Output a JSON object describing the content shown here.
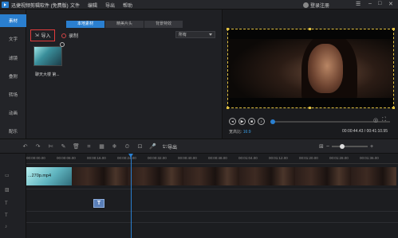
{
  "app": {
    "title": "迅捷视频剪辑软件 (免费版)",
    "menu": [
      "文件",
      "编辑",
      "导出",
      "帮助"
    ],
    "login": "登录注册"
  },
  "sidebar": {
    "items": [
      "素材",
      "文字",
      "滤镜",
      "叠附",
      "转场",
      "动画",
      "配乐"
    ],
    "active_index": 0
  },
  "media": {
    "tabs": [
      "本地素材",
      "精美片头",
      "背景特效"
    ],
    "active_tab": 0,
    "import_label": "导入",
    "record_label": "录制",
    "filter_value": "所有",
    "item_caption": "聊天大楼 第..."
  },
  "preview": {
    "ratio_label": "宽高比:",
    "ratio_value": "16:9",
    "time": "00:00:44.43 / 00:41:10.95",
    "progress": 0.0
  },
  "toolbar": {
    "export_label": "导出"
  },
  "timeline": {
    "ticks": [
      "00:00:00.00",
      "00:00:08.00",
      "00:00:16.00",
      "00:00:24.00",
      "00:00:32.00",
      "00:00:40.00",
      "00:00:48.00",
      "00:01:04.00",
      "00:01:12.00",
      "00:01:20.00",
      "00:01:28.00",
      "00:01:36.00"
    ],
    "clip_name": "...270p.mp4",
    "text_clip_label": "T"
  },
  "colors": {
    "accent": "#2a7fd0",
    "highlight_box": "#e23b3b"
  }
}
